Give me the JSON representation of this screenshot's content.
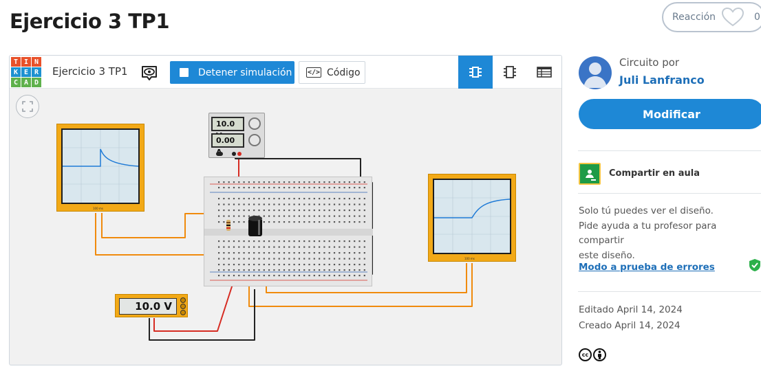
{
  "page": {
    "title": "Ejercicio 3 TP1"
  },
  "reaction": {
    "label": "Reacción",
    "count": "0",
    "icon": "heart-outline-icon"
  },
  "toolbar": {
    "logo_letters": [
      "T",
      "I",
      "N",
      "K",
      "E",
      "R",
      "C",
      "A",
      "D"
    ],
    "logo_colors": [
      "#e8512a",
      "#e8512a",
      "#e8512a",
      "#1d91d0",
      "#1d91d0",
      "#1d91d0",
      "#5fb14c",
      "#5fb14c",
      "#5fb14c"
    ],
    "design_name": "Ejercicio 3 TP1",
    "stop_label": "Detener simulación",
    "code_label": "Código",
    "code_icon_text": "</>",
    "views": [
      "circuit-view-icon",
      "schematic-view-icon",
      "component-list-icon"
    ]
  },
  "circuit": {
    "psu_voltage": "10.0 V",
    "psu_current": "0.00 A",
    "multimeter_value": "10.0 V",
    "scope_label": "100 ms"
  },
  "sidebar": {
    "made_by_label": "Circuito por",
    "author": "Juli Lanfranco",
    "modify_label": "Modificar",
    "share_label": "Compartir en aula",
    "privacy_lines": [
      "Solo tú puedes ver el diseño.",
      "Pide ayuda a tu profesor para compartir",
      "este diseño."
    ],
    "safe_mode_label": "Modo a prueba de errores",
    "edited": "Editado April 14, 2024",
    "created": "Creado April 14, 2024",
    "license_icons": [
      "creative-commons-icon",
      "attribution-icon"
    ]
  },
  "colors": {
    "accent": "#1e88d6",
    "link": "#1e6fb8",
    "instrument": "#f2a917",
    "wire_red": "#d62b22",
    "wire_orange": "#f08a0c",
    "wire_black": "#222222",
    "trace_blue": "#1e7ad6"
  }
}
